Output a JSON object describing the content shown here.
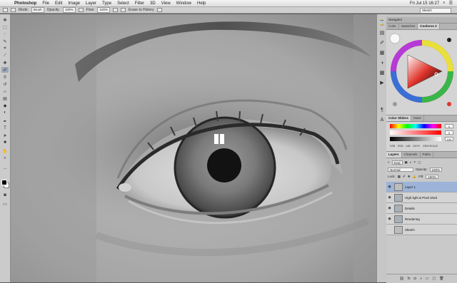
{
  "menubar": {
    "apple_glyph": "",
    "app_name": "Photoshop",
    "menus": [
      "File",
      "Edit",
      "Image",
      "Layer",
      "Type",
      "Select",
      "Filter",
      "3D",
      "View",
      "Window",
      "Help"
    ],
    "clock": "Fri Jul 15  16:27",
    "search_placeholder": "Search"
  },
  "options_bar": {
    "mode_label": "Mode:",
    "mode_value": "Brush",
    "opacity_label": "Opacity:",
    "opacity_value": "100%",
    "flow_label": "Flow:",
    "flow_value": "100%",
    "erase_history": "Erase to History",
    "workspace_field": "Sketch"
  },
  "panels": {
    "navigator_tab": "Navigator",
    "color_tabs": [
      "Color",
      "Swatches",
      "Coolorus 2"
    ],
    "sliders_tabs": [
      "Color Sliders",
      "Mixer"
    ],
    "slider_values": [
      "0",
      "0",
      "100"
    ],
    "slider_buttons": [
      "HSB",
      "RGB",
      "LAB",
      "CMYK",
      "GRAYSCALE"
    ],
    "layers_tabs": [
      "Layers",
      "Channels",
      "Paths"
    ],
    "kind_label": "Kind",
    "blend_mode": "Normal",
    "opacity_label": "Opacity:",
    "opacity_value": "100%",
    "lock_label": "Lock:",
    "fill_label": "Fill:",
    "fill_value": "100%",
    "layers": [
      {
        "name": "Layer 1",
        "selected": true,
        "folder": false
      },
      {
        "name": "High light & Pixel shed",
        "selected": false,
        "folder": true
      },
      {
        "name": "Details",
        "selected": false,
        "folder": true
      },
      {
        "name": "Rendering",
        "selected": false,
        "folder": true
      },
      {
        "name": "Sketch",
        "selected": false,
        "folder": false
      }
    ]
  },
  "colors": {
    "menubar": "#e6e6e6",
    "panel": "#d4d4d4",
    "selected_layer": "#9db4d8",
    "accent_red": "#e0342c"
  },
  "icons": {
    "tools": [
      "move-icon",
      "marquee-icon",
      "lasso-icon",
      "quick-select-icon",
      "crop-icon",
      "eyedropper-icon",
      "healing-icon",
      "brush-icon",
      "clone-stamp-icon",
      "history-brush-icon",
      "eraser-icon",
      "gradient-icon",
      "blur-icon",
      "dodge-icon",
      "pen-icon",
      "type-icon",
      "path-select-icon",
      "shape-icon",
      "hand-icon",
      "zoom-icon"
    ]
  }
}
